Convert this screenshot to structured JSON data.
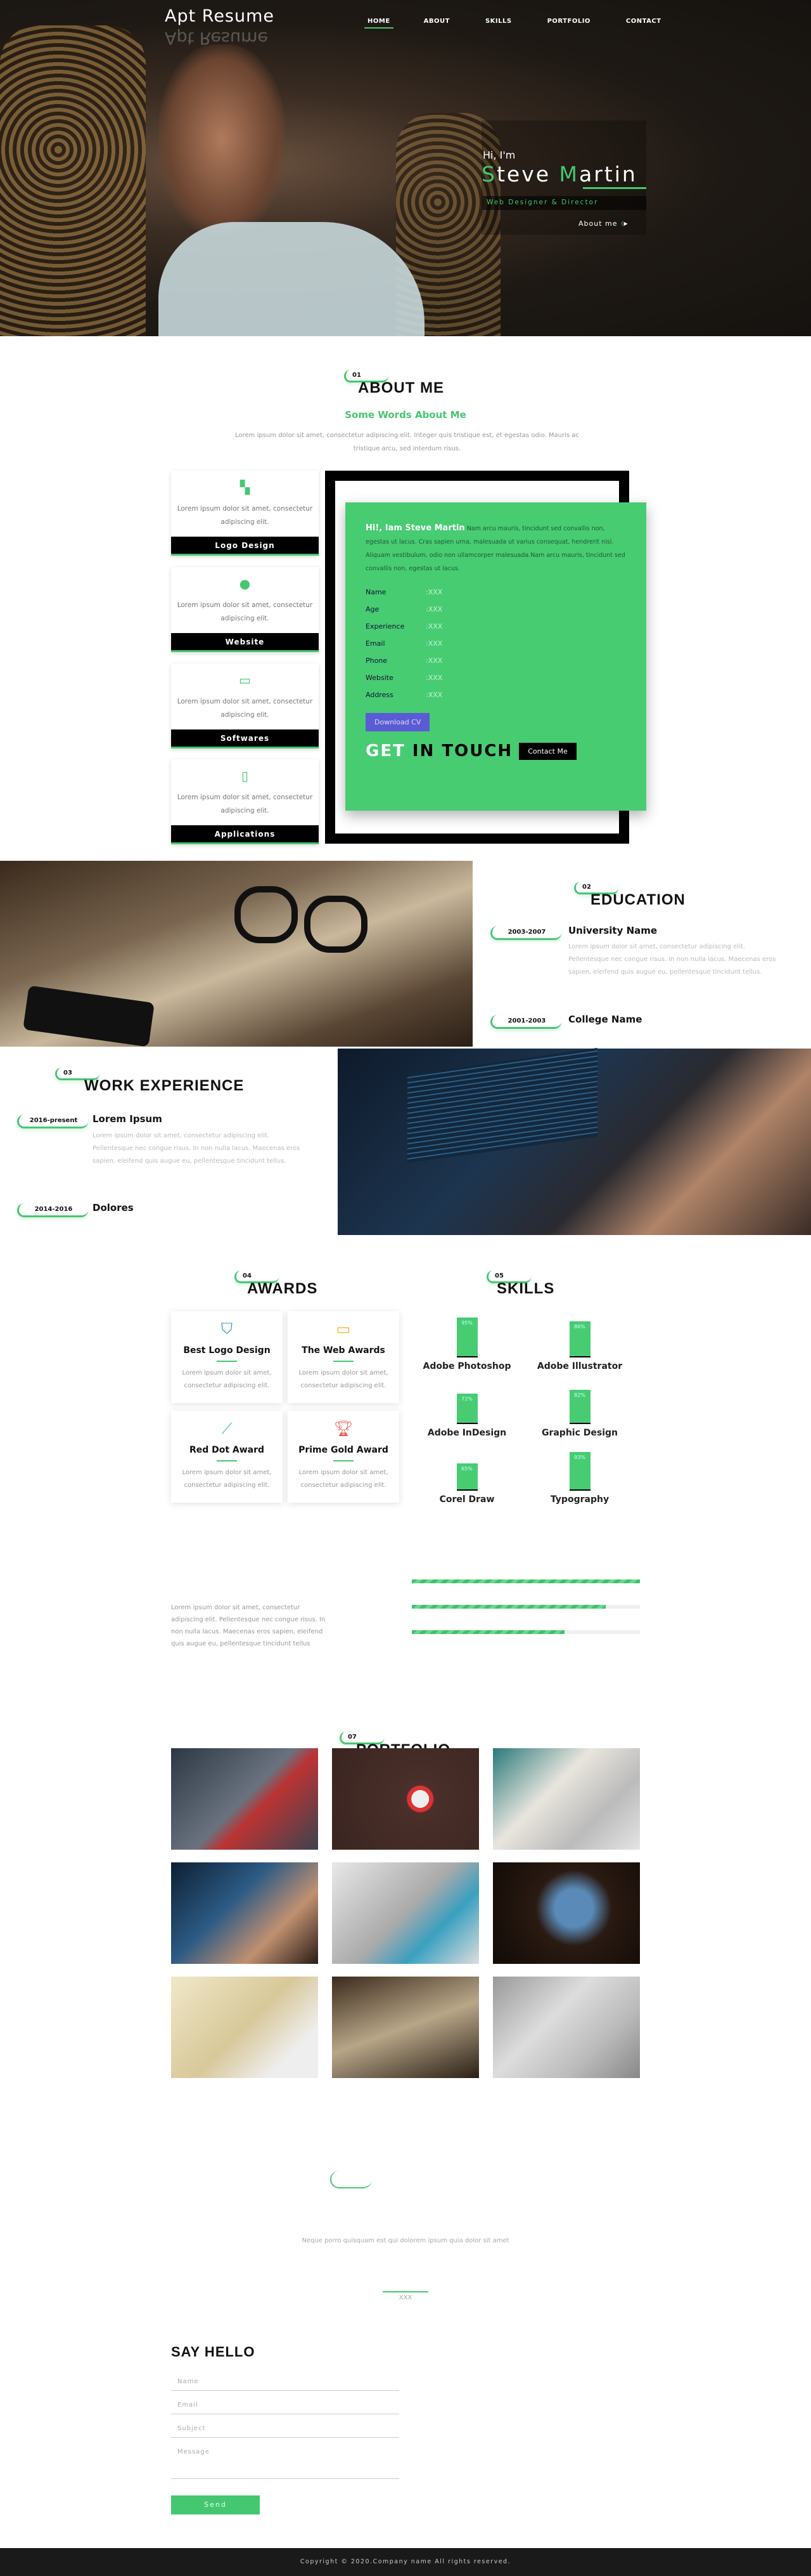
{
  "brand": {
    "logo": "Apt Resume",
    "accent": "#45c771"
  },
  "nav": [
    {
      "label": "HOME",
      "active": true
    },
    {
      "label": "ABOUT"
    },
    {
      "label": "SKILLS"
    },
    {
      "label": "PORTFOLIO"
    },
    {
      "label": "CONTACT"
    }
  ],
  "hero": {
    "greeting": "Hi, I'm",
    "name_first_initial": "S",
    "name_first_rest": "teve ",
    "name_last_initial": "M",
    "name_last_rest": "artin",
    "role": "Web Designer & Director",
    "cta": "About me"
  },
  "about": {
    "number": "01",
    "title": "ABOUT ME",
    "subtitle": "Some Words About Me",
    "text": "Lorem ipsum dolor sit amet, consectetur adipiscing elit. Integer quis tristique est, et egestas odio. Mauris ac tristique arcu, sed interdum risus.",
    "services": [
      {
        "icon": "logo-design-icon",
        "text": "Lorem ipsum dolor sit amet, consectetur adipiscing elit.",
        "label": "Logo Design"
      },
      {
        "icon": "globe-icon",
        "text": "Lorem ipsum dolor sit amet, consectetur adipiscing elit.",
        "label": "Website"
      },
      {
        "icon": "monitor-icon",
        "text": "Lorem ipsum dolor sit amet, consectetur adipiscing elit.",
        "label": "Softwares"
      },
      {
        "icon": "mobile-icon",
        "text": "Lorem ipsum dolor sit amet, consectetur adipiscing elit.",
        "label": "Applications"
      }
    ],
    "intro_bold": "Hi!, Iam Steve Martin",
    "intro_text": " Nam arcu mauris, tincidunt sed convallis non, egestas ut lacus. Cras sapien urna, malesuada ut varius consequat, hendrerit nisl. Aliquam vestibulum, odio non ullamcorper malesuada.Nam arcu mauris, tincidunt sed convallis non, egestas ut lacus.",
    "info": [
      {
        "k": "Name",
        "v": ":XXX"
      },
      {
        "k": "Age",
        "v": ":XXX"
      },
      {
        "k": "Experience",
        "v": ":XXX"
      },
      {
        "k": "Email",
        "v": ":XXX"
      },
      {
        "k": "Phone",
        "v": ":XXX"
      },
      {
        "k": "Website",
        "v": ":XXX"
      },
      {
        "k": "Address",
        "v": ":XXX"
      }
    ],
    "download": "Download CV",
    "get": "GET",
    "in_touch": "IN TOUCH",
    "contact": "Contact Me"
  },
  "education": {
    "number": "02",
    "title": "EDUCATION",
    "items": [
      {
        "date": "2003-2007",
        "title": "University Name",
        "text": "Lorem ipsum dolor sit amet, consectetur adipiscing elit. Pellentesque nec congue risus. In non nulla lacus. Maecenas eros sapien, eleifend quis augue eu, pellentesque tincidunt tellus."
      },
      {
        "date": "2001-2003",
        "title": "College Name"
      }
    ]
  },
  "work": {
    "number": "03",
    "title": "WORK EXPERIENCE",
    "items": [
      {
        "date": "2016-present",
        "title": "Lorem Ipsum",
        "text": "Lorem ipsum dolor sit amet, consectetur adipiscing elit. Pellentesque nec congue risus. In non nulla lacus. Maecenas eros sapien, eleifend quis augue eu, pellentesque tincidunt tellus."
      },
      {
        "date": "2014-2016",
        "title": "Dolores"
      }
    ]
  },
  "awards": {
    "number": "04",
    "title": "AWARDS",
    "items": [
      {
        "icon": "bookmark-icon",
        "color": "#2a9ab8",
        "title": "Best Logo Design",
        "text": "Lorem ipsum dolor sit amet, consectetur adipiscing elit."
      },
      {
        "icon": "monitor-icon",
        "color": "#f2b619",
        "title": "The Web Awards",
        "text": "Lorem ipsum dolor sit amet, consectetur adipiscing elit."
      },
      {
        "icon": "magic-wand-icon",
        "color": "#3fcf97",
        "title": "Red Dot Award",
        "text": "Lorem ipsum dolor sit amet, consectetur adipiscing elit."
      },
      {
        "icon": "trophy-icon",
        "color": "#f05a5a",
        "title": "Prime Gold Award",
        "text": "Lorem ipsum dolor sit amet, consectetur adipiscing elit."
      }
    ]
  },
  "skills": {
    "number": "05",
    "title": "SKILLS",
    "items": [
      {
        "name": "Adobe Photoshop",
        "pct": "95%",
        "value": 95
      },
      {
        "name": "Adobe Illustrator",
        "pct": "86%",
        "value": 86
      },
      {
        "name": "Adobe InDesign",
        "pct": "72%",
        "value": 72
      },
      {
        "name": "Graphic Design",
        "pct": "82%",
        "value": 82
      },
      {
        "name": "Corel Draw",
        "pct": "65%",
        "value": 65
      },
      {
        "name": "Typography",
        "pct": "93%",
        "value": 93
      }
    ]
  },
  "progress": {
    "text": "Lorem ipsum dolor sit amet, consectetur adipiscing elit. Pellentesque nec congue risus. In non nulla lacus. Maecenas eros sapien, eleifend quis augue eu, pellentesque tincidunt tellus",
    "values": [
      100,
      85,
      67
    ]
  },
  "portfolio": {
    "number": "07",
    "title": "PORTFOLIO"
  },
  "testimonial": {
    "quote": "Neque porro quisquam est qui dolorem ipsum quia dolor sit amet",
    "author": "XXX"
  },
  "contact": {
    "title": "SAY HELLO",
    "name": "Name",
    "email": "Email",
    "subject": "Subject",
    "message": "Message",
    "send": "Send"
  },
  "footer": {
    "copyright": "Copyright © 2020.Company name All rights reserved."
  }
}
